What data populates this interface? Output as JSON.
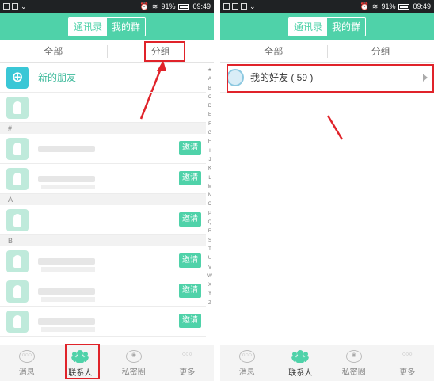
{
  "statusbar": {
    "battery": "91%",
    "time": "09:49"
  },
  "header": {
    "tab_contacts": "通讯录",
    "tab_groups": "我的群"
  },
  "filter": {
    "all": "全部",
    "grouping": "分组"
  },
  "left": {
    "new_friends": "新的朋友",
    "sections": {
      "hash": "#",
      "a": "A",
      "b": "B"
    },
    "invite_label": "邀请",
    "index_letters": [
      "★",
      "A",
      "B",
      "C",
      "D",
      "E",
      "F",
      "G",
      "H",
      "I",
      "J",
      "K",
      "L",
      "M",
      "N",
      "O",
      "P",
      "Q",
      "R",
      "S",
      "T",
      "U",
      "V",
      "W",
      "X",
      "Y",
      "Z"
    ]
  },
  "right": {
    "group_name": "我的好友 ( 59 )"
  },
  "nav": {
    "messages": "消息",
    "contacts": "联系人",
    "private": "私密圈",
    "more": "更多"
  },
  "colors": {
    "accent": "#4fd2a9",
    "highlight": "#e0232a"
  },
  "icons": {
    "new_friend": "plus-circle-icon",
    "avatar": "person-icon",
    "group": "group-avatar-icon",
    "expand": "triangle-right-icon"
  }
}
